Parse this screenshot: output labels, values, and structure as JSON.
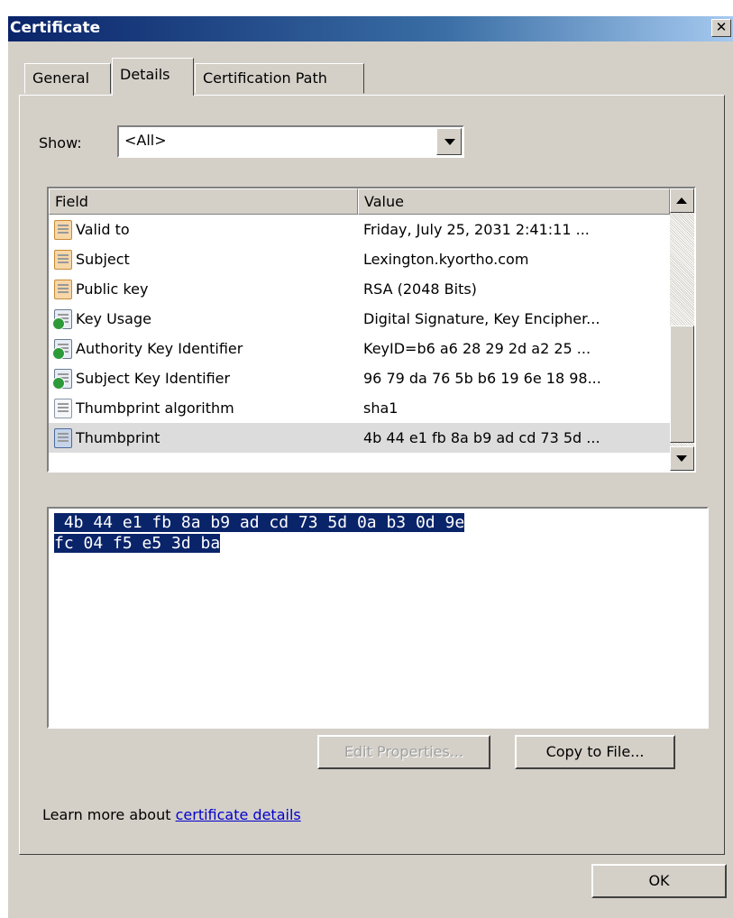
{
  "window": {
    "title": "Certificate"
  },
  "tabs": [
    {
      "label": "General"
    },
    {
      "label": "Details"
    },
    {
      "label": "Certification Path"
    }
  ],
  "show": {
    "label": "Show:",
    "value": "<All>"
  },
  "list": {
    "headers": {
      "field": "Field",
      "value": "Value"
    },
    "rows": [
      {
        "field": "Valid to",
        "value": "Friday, July 25, 2031 2:41:11 ...",
        "icon": "cert-field-icon"
      },
      {
        "field": "Subject",
        "value": "Lexington.kyortho.com",
        "icon": "cert-field-icon"
      },
      {
        "field": "Public key",
        "value": "RSA (2048 Bits)",
        "icon": "cert-field-icon"
      },
      {
        "field": "Key Usage",
        "value": "Digital Signature, Key Encipher...",
        "icon": "cert-extension-icon"
      },
      {
        "field": "Authority Key Identifier",
        "value": "KeyID=b6 a6 28 29 2d a2 25 ...",
        "icon": "cert-extension-icon"
      },
      {
        "field": "Subject Key Identifier",
        "value": "96 79 da 76 5b b6 19 6e 18 98...",
        "icon": "cert-extension-icon"
      },
      {
        "field": "Thumbprint algorithm",
        "value": "sha1",
        "icon": "cert-property-icon"
      },
      {
        "field": "Thumbprint",
        "value": "4b 44 e1 fb 8a b9 ad cd 73 5d ...",
        "icon": "cert-property-icon"
      }
    ]
  },
  "detail": {
    "line1": " 4b 44 e1 fb 8a b9 ad cd 73 5d 0a b3 0d 9e",
    "line2": "fc 04 f5 e5 3d ba"
  },
  "buttons": {
    "edit_properties": "Edit Properties...",
    "copy_to_file": "Copy to File...",
    "ok": "OK"
  },
  "learn_more": {
    "prefix": "Learn more about ",
    "link": "certificate details"
  }
}
